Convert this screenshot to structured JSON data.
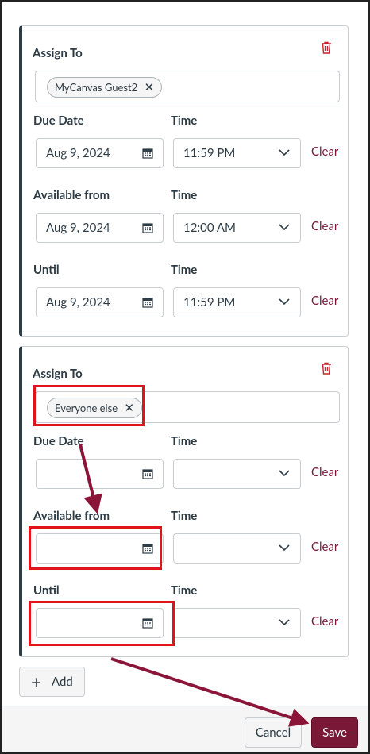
{
  "assign_cards": [
    {
      "assign_label": "Assign To",
      "assignee": "MyCanvas Guest2",
      "due_label": "Due Date",
      "due_date": "Aug 9, 2024",
      "due_time_label": "Time",
      "due_time": "11:59 PM",
      "available_label": "Available from",
      "available_date": "Aug 9, 2024",
      "available_time_label": "Time",
      "available_time": "12:00 AM",
      "until_label": "Until",
      "until_date": "Aug 9, 2024",
      "until_time_label": "Time",
      "until_time": "11:59 PM",
      "clear_label": "Clear"
    },
    {
      "assign_label": "Assign To",
      "assignee": "Everyone else",
      "due_label": "Due Date",
      "due_date": "",
      "due_time_label": "Time",
      "due_time": "",
      "available_label": "Available from",
      "available_date": "",
      "available_time_label": "Time",
      "available_time": "",
      "until_label": "Until",
      "until_date": "",
      "until_time_label": "Time",
      "until_time": "",
      "clear_label": "Clear"
    }
  ],
  "add_button": {
    "label": "Add",
    "icon": "plus-icon"
  },
  "footer": {
    "cancel_label": "Cancel",
    "save_label": "Save"
  },
  "colors": {
    "accent": "#7a1937",
    "annotation_red": "#e0151b",
    "arrow": "#8b1538",
    "border": "#c7cdd1",
    "text": "#2d3b45"
  }
}
